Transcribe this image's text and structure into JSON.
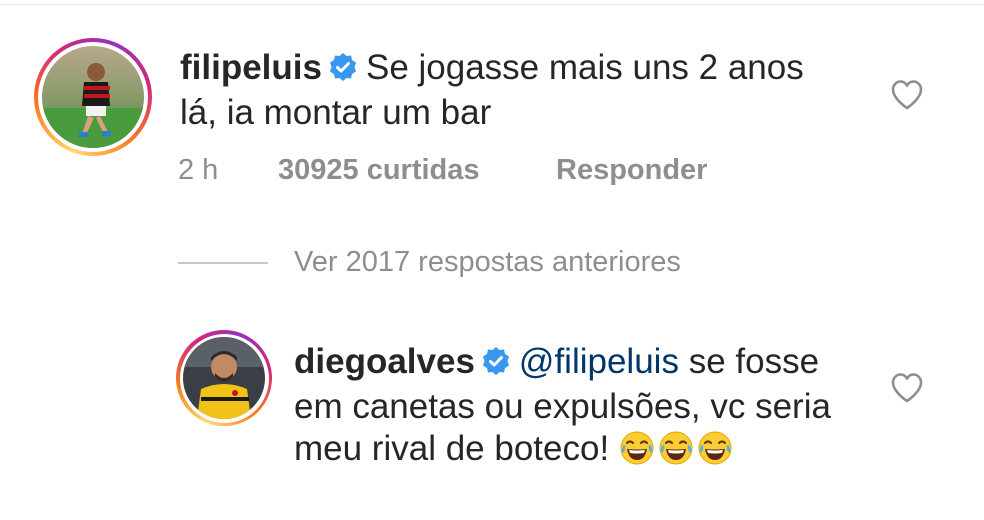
{
  "comments": [
    {
      "username": "filipeluis",
      "verified": true,
      "text": "Se jogasse mais uns 2 anos lá, ia montar um bar",
      "time": "2 h",
      "likes": "30925 curtidas",
      "reply_label": "Responder",
      "avatar_icon": "user-avatar-soccer-player"
    },
    {
      "username": "diegoalves",
      "verified": true,
      "mention": "@filipeluis",
      "text": "se fosse em canetas ou expulsões, vc seria meu rival de boteco!",
      "emoji": "face-with-tears-of-joy",
      "emoji_count": 3,
      "avatar_icon": "user-avatar-goalkeeper"
    }
  ],
  "view_replies": {
    "label": "Ver 2017 respostas anteriores"
  },
  "icons": {
    "like": "heart-outline-icon",
    "verified": "verified-badge-icon"
  },
  "colors": {
    "text": "#262626",
    "secondary_text": "#8e8e8e",
    "mention": "#00376b",
    "verified_blue": "#3897f0",
    "story_ring_start": "#feda75",
    "story_ring_end": "#d62976"
  }
}
